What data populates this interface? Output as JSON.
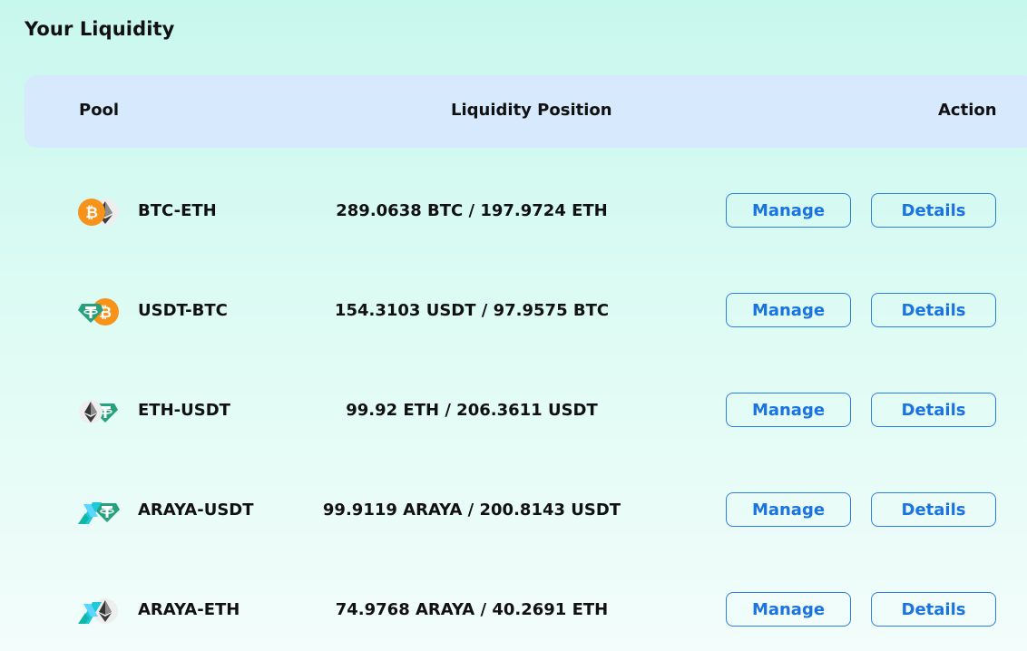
{
  "page": {
    "title": "Your Liquidity"
  },
  "table": {
    "headers": {
      "pool": "Pool",
      "position": "Liquidity Position",
      "action": "Action"
    },
    "rows": [
      {
        "pair": "BTC-ETH",
        "position": "289.0638 BTC / 197.9724 ETH",
        "icons": [
          "btc-icon",
          "eth-icon"
        ],
        "manage_label": "Manage",
        "details_label": "Details"
      },
      {
        "pair": "USDT-BTC",
        "position": "154.3103 USDT / 97.9575 BTC",
        "icons": [
          "usdt-icon",
          "btc-icon"
        ],
        "manage_label": "Manage",
        "details_label": "Details"
      },
      {
        "pair": "ETH-USDT",
        "position": "99.92 ETH / 206.3611 USDT",
        "icons": [
          "eth-icon",
          "usdt-icon"
        ],
        "manage_label": "Manage",
        "details_label": "Details"
      },
      {
        "pair": "ARAYA-USDT",
        "position": "99.9119 ARAYA / 200.8143 USDT",
        "icons": [
          "araya-icon",
          "usdt-icon"
        ],
        "manage_label": "Manage",
        "details_label": "Details"
      },
      {
        "pair": "ARAYA-ETH",
        "position": "74.9768 ARAYA / 40.2691 ETH",
        "icons": [
          "araya-icon",
          "eth-icon"
        ],
        "manage_label": "Manage",
        "details_label": "Details"
      }
    ]
  },
  "colors": {
    "accent": "#1a73e0",
    "header_bg": "#d6e9fd",
    "btc": "#f7931a",
    "usdt": "#26a17b",
    "araya_cyan": "#1ec8d8"
  }
}
